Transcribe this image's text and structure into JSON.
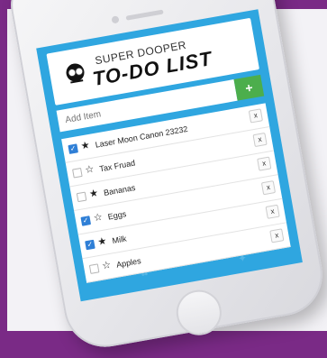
{
  "app": {
    "banner_top": "SUPER DOOPER",
    "banner_main": "TO-DO LIST"
  },
  "add_form": {
    "placeholder": "Add Item",
    "button_label": "+"
  },
  "items": [
    {
      "label": "Laser Moon Canon 23232",
      "checked": true,
      "starred": true,
      "delete_label": "x"
    },
    {
      "label": "Tax Fruad",
      "checked": false,
      "starred": false,
      "delete_label": "x"
    },
    {
      "label": "Bananas",
      "checked": false,
      "starred": true,
      "delete_label": "x"
    },
    {
      "label": "Eggs",
      "checked": true,
      "starred": false,
      "delete_label": "x"
    },
    {
      "label": "Milk",
      "checked": true,
      "starred": true,
      "delete_label": "x"
    },
    {
      "label": "Apples",
      "checked": false,
      "starred": false,
      "delete_label": "x"
    }
  ],
  "colors": {
    "background": "#7a2a86",
    "screen": "#2fa6e0",
    "add_button": "#4cae4c",
    "checkbox_on": "#2f7fd6"
  },
  "icons": {
    "star_filled": "★",
    "star_empty": "☆",
    "check": "✓"
  }
}
